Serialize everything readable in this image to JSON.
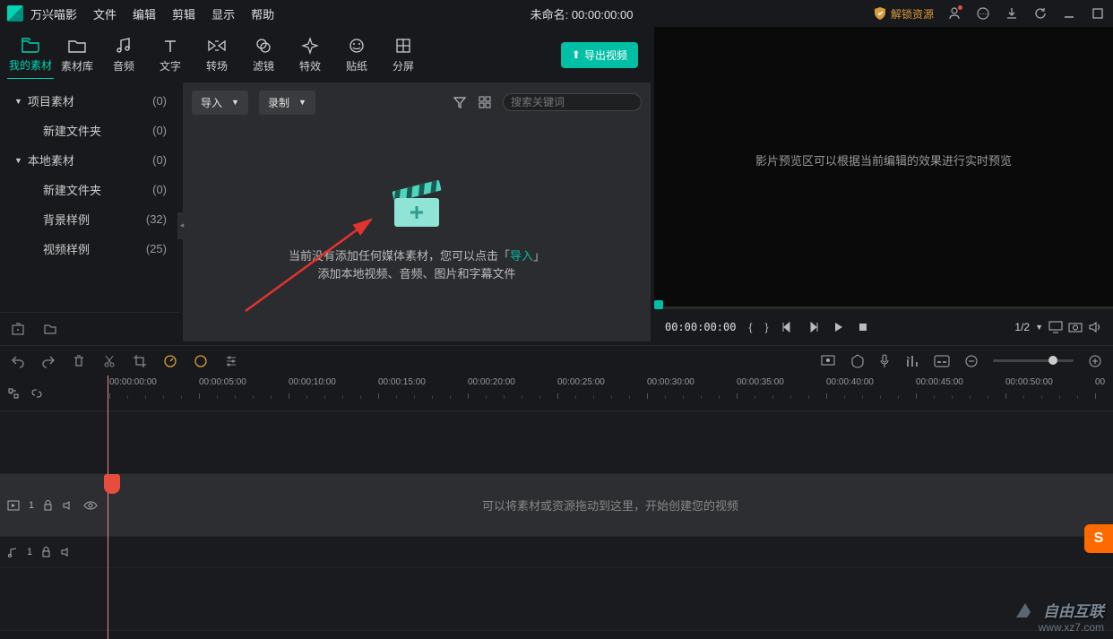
{
  "app_name": "万兴喵影",
  "menu": [
    "文件",
    "编辑",
    "剪辑",
    "显示",
    "帮助"
  ],
  "title_center_label": "未命名:",
  "title_center_time": "00:00:00:00",
  "unlock_label": "解锁资源",
  "tabs": {
    "items": [
      {
        "label": "我的素材",
        "icon": "folder-open"
      },
      {
        "label": "素材库",
        "icon": "folder"
      },
      {
        "label": "音频",
        "icon": "music"
      },
      {
        "label": "文字",
        "icon": "text"
      },
      {
        "label": "转场",
        "icon": "transition"
      },
      {
        "label": "滤镜",
        "icon": "filter"
      },
      {
        "label": "特效",
        "icon": "sparkle"
      },
      {
        "label": "贴纸",
        "icon": "smiley"
      },
      {
        "label": "分屏",
        "icon": "split"
      }
    ],
    "export_label": "导出视频"
  },
  "sidebar": {
    "groups": [
      {
        "label": "项目素材",
        "count": "(0)",
        "expanded": true,
        "children": [
          {
            "label": "新建文件夹",
            "count": "(0)"
          }
        ]
      },
      {
        "label": "本地素材",
        "count": "(0)",
        "expanded": true,
        "children": [
          {
            "label": "新建文件夹",
            "count": "(0)"
          },
          {
            "label": "背景样例",
            "count": "(32)"
          },
          {
            "label": "视频样例",
            "count": "(25)"
          }
        ]
      }
    ]
  },
  "content": {
    "import_label": "导入",
    "record_label": "录制",
    "search_placeholder": "搜索关键词",
    "empty_line1_pre": "当前没有添加任何媒体素材，您可以点击「",
    "empty_line1_link": "导入",
    "empty_line1_post": "」",
    "empty_line2": "添加本地视频、音频、图片和字幕文件"
  },
  "preview": {
    "placeholder": "影片预览区可以根据当前编辑的效果进行实时预览",
    "time": "00:00:00:00",
    "ratio": "1/2"
  },
  "timeline": {
    "ticks": [
      "00:00:00:00",
      "00:00:05:00",
      "00:00:10:00",
      "00:00:15:00",
      "00:00:20:00",
      "00:00:25:00",
      "00:00:30:00",
      "00:00:35:00",
      "00:00:40:00",
      "00:00:45:00",
      "00:00:50:00",
      "00"
    ],
    "video_hint": "可以将素材或资源拖动到这里，开始创建您的视频",
    "video_track_num": "1",
    "audio_track_num": "1"
  },
  "watermark": {
    "text": "自由互联",
    "url": "www.xz7.com"
  }
}
